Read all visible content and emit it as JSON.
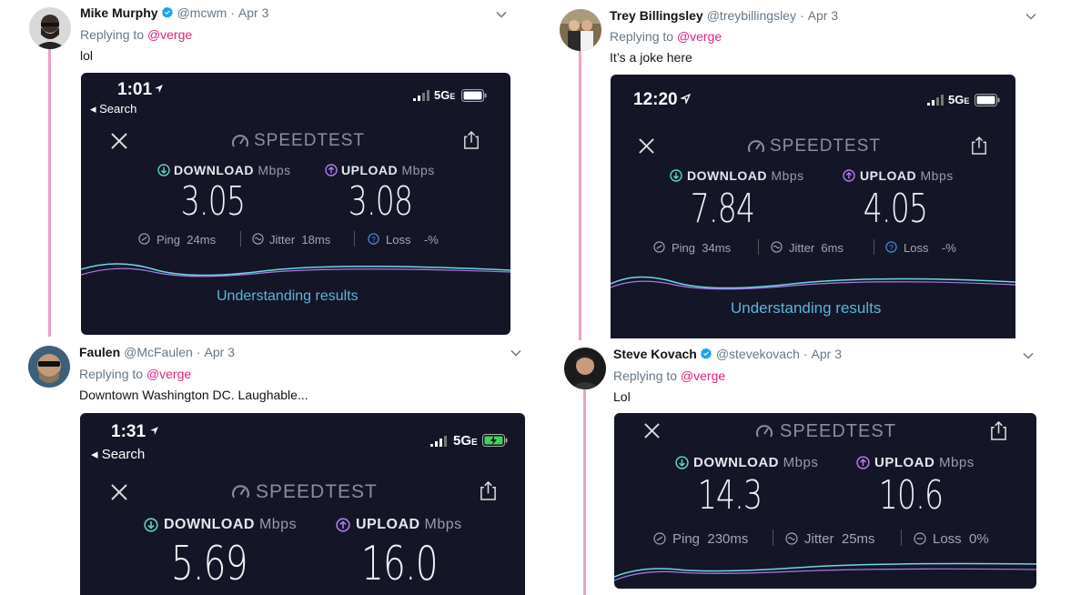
{
  "tweets": [
    {
      "name": "Mike Murphy",
      "verified": true,
      "handle": "@mcwm",
      "date": "Apr 3",
      "replying_prefix": "Replying to",
      "replying_to": "@verge",
      "text": "lol",
      "speedtest": {
        "time": "1:01",
        "back_label": "◂ Search",
        "network": "5G",
        "network_sub": "E",
        "brand": "SPEEDTEST",
        "download_label": "DOWNLOAD",
        "upload_label": "UPLOAD",
        "unit": "Mbps",
        "download": "3.05",
        "upload": "3.08",
        "ping_label": "Ping",
        "ping": "24",
        "jitter_label": "Jitter",
        "jitter": "18",
        "loss_label": "Loss",
        "loss": "-",
        "ms": "ms",
        "pct": "%",
        "results_link": "Understanding results"
      }
    },
    {
      "name": "Trey Billingsley",
      "verified": false,
      "handle": "@treybillingsley",
      "date": "Apr 3",
      "replying_prefix": "Replying to",
      "replying_to": "@verge",
      "text": "It’s a joke here",
      "speedtest": {
        "time": "12:20",
        "network": "5G",
        "network_sub": "E",
        "brand": "SPEEDTEST",
        "download_label": "DOWNLOAD",
        "upload_label": "UPLOAD",
        "unit": "Mbps",
        "download": "7.84",
        "upload": "4.05",
        "ping_label": "Ping",
        "ping": "34",
        "jitter_label": "Jitter",
        "jitter": "6",
        "loss_label": "Loss",
        "loss": "-",
        "ms": "ms",
        "pct": "%",
        "results_link": "Understanding results"
      }
    },
    {
      "name": "Faulen",
      "verified": false,
      "handle": "@McFaulen",
      "date": "Apr 3",
      "replying_prefix": "Replying to",
      "replying_to": "@verge",
      "text": "Downtown Washington DC. Laughable...",
      "speedtest": {
        "time": "1:31",
        "back_label": "◂ Search",
        "network": "5G",
        "network_sub": "E",
        "brand": "SPEEDTEST",
        "download_label": "DOWNLOAD",
        "upload_label": "UPLOAD",
        "unit": "Mbps",
        "download": "5.69",
        "upload": "16.0"
      }
    },
    {
      "name": "Steve Kovach",
      "verified": true,
      "handle": "@stevekovach",
      "date": "Apr 3",
      "replying_prefix": "Replying to",
      "replying_to": "@verge",
      "text": "Lol",
      "speedtest": {
        "brand": "SPEEDTEST",
        "download_label": "DOWNLOAD",
        "upload_label": "UPLOAD",
        "unit": "Mbps",
        "download": "14.3",
        "upload": "10.6",
        "ping_label": "Ping",
        "ping": "230",
        "jitter_label": "Jitter",
        "jitter": "25",
        "loss_label": "Loss",
        "loss": "0",
        "ms": "ms",
        "pct": "%"
      }
    }
  ],
  "colors": {
    "thread_line": "#ec9fc9",
    "mention": "#e0217f",
    "verified": "#1da1f2",
    "speedtest_bg": "#141527",
    "download_accent": "#5fd3c6",
    "upload_accent": "#b27cf2",
    "link": "#5ab8d8"
  }
}
